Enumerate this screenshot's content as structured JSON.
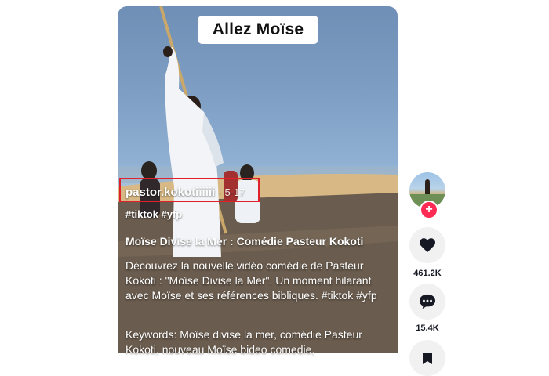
{
  "video": {
    "top_caption": "Allez Moïse",
    "author": "pastor.kokotiiiiii",
    "separator": "·",
    "date": "5-17",
    "tags": "#tiktok #yfp",
    "title": "Moïse Divise la Mer : Comédie Pasteur Kokoti",
    "description": "Découvrez la nouvelle vidéo comédie de Pasteur Kokoti : \"Moïse Divise la Mer\". Un moment hilarant avec Moïse et ses références bibliques. #tiktok #yfp",
    "keywords": "Keywords: Moïse divise la mer, comédie Pasteur Kokoti, nouveau Moïse bideo comedie,"
  },
  "actions": {
    "likes": "461.2K",
    "comments": "15.4K",
    "follow_symbol": "+"
  },
  "colors": {
    "highlight": "#e0202a",
    "follow": "#fe2c55",
    "button_bg": "#f1f1f2"
  }
}
